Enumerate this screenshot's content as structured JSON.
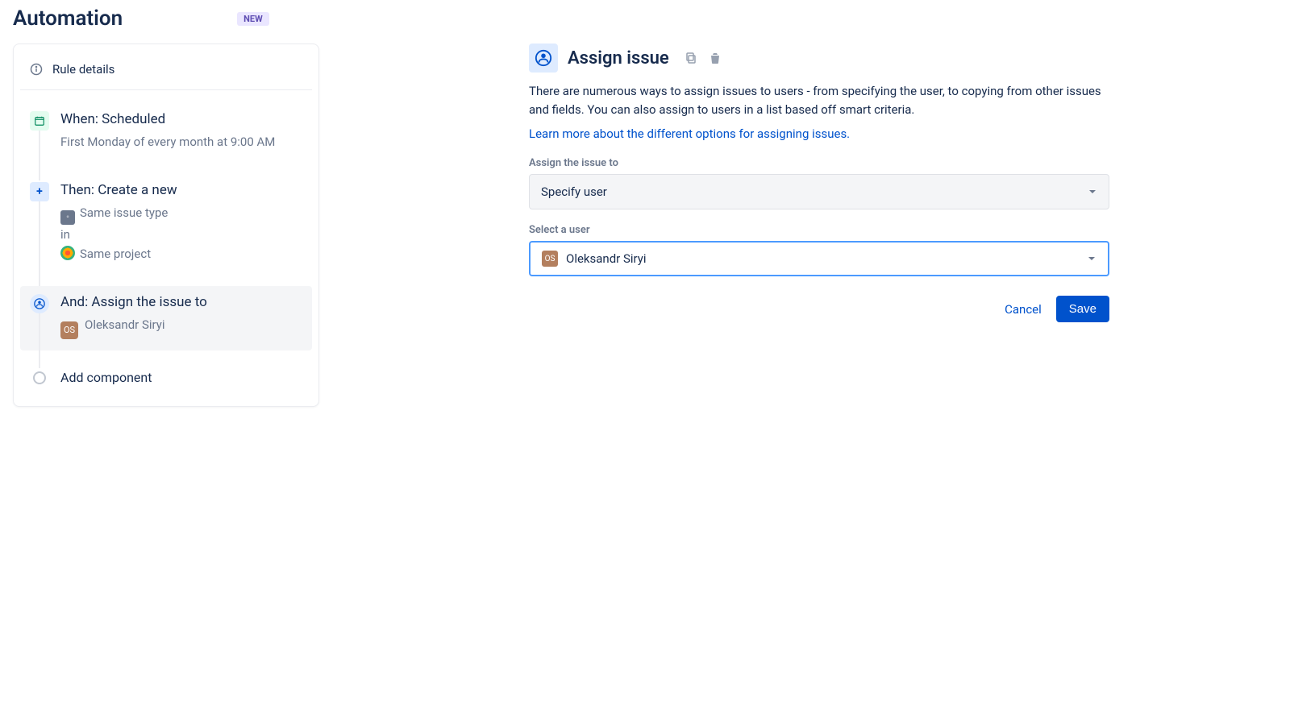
{
  "header": {
    "title": "Automation",
    "badge": "NEW"
  },
  "panel": {
    "rule_details_label": "Rule details",
    "steps": {
      "when": {
        "title": "When: Scheduled",
        "sub": "First Monday of every month at 9:00 AM"
      },
      "then": {
        "title": "Then: Create a new",
        "line1": "Same issue type",
        "line2_prefix": "in",
        "line2_value": "Same project"
      },
      "and": {
        "title": "And: Assign the issue to",
        "user": "Oleksandr Siryi"
      }
    },
    "add_component_label": "Add component"
  },
  "content": {
    "title": "Assign issue",
    "description": "There are numerous ways to assign issues to users - from specifying the user, to copying from other issues and fields. You can also assign to users in a list based off smart criteria.",
    "learn_more": "Learn more about the different options for assigning issues.",
    "assign_to_label": "Assign the issue to",
    "assign_to_value": "Specify user",
    "select_user_label": "Select a user",
    "selected_user": "Oleksandr Siryi",
    "cancel_label": "Cancel",
    "save_label": "Save"
  }
}
